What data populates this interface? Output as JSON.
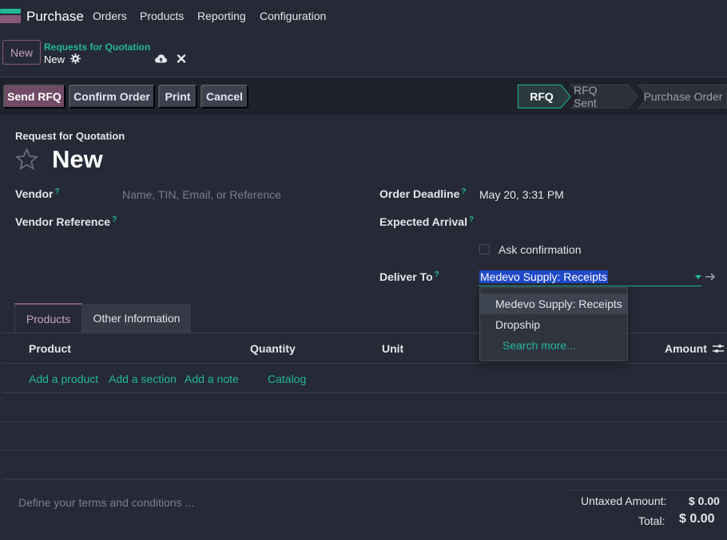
{
  "topnav": {
    "app_name": "Purchase",
    "items": [
      "Orders",
      "Products",
      "Reporting",
      "Configuration"
    ]
  },
  "control": {
    "new_label": "New",
    "breadcrumb_parent": "Requests for Quotation",
    "breadcrumb_current": "New",
    "icons": [
      "gear-icon",
      "cloud-upload-icon",
      "close-icon"
    ]
  },
  "statusbar": {
    "buttons": [
      "Send RFQ",
      "Confirm Order",
      "Print",
      "Cancel"
    ],
    "stages": [
      "RFQ",
      "RFQ Sent",
      "Purchase Order"
    ],
    "active_stage": "RFQ"
  },
  "form": {
    "subtitle": "Request for Quotation",
    "title": "New",
    "vendor_label": "Vendor",
    "vendor_placeholder": "Name, TIN, Email, or Reference",
    "vendor_ref_label": "Vendor Reference",
    "order_deadline_label": "Order Deadline",
    "order_deadline_value": "May 20, 3:31 PM",
    "expected_arrival_label": "Expected Arrival",
    "ask_confirmation_label": "Ask confirmation",
    "deliver_to_label": "Deliver To",
    "deliver_to_value": "Medevo Supply: Receipts",
    "help_marker": "?"
  },
  "dropdown": {
    "options": [
      "Medevo Supply: Receipts",
      "Dropship"
    ],
    "search_more": "Search more..."
  },
  "tabs": [
    "Products",
    "Other Information"
  ],
  "lines": {
    "headers": [
      "Product",
      "Quantity",
      "Unit",
      "Amount"
    ],
    "actions": [
      "Add a product",
      "Add a section",
      "Add a note",
      "Catalog"
    ]
  },
  "footer": {
    "terms_placeholder": "Define your terms and conditions ...",
    "untaxed_label": "Untaxed Amount:",
    "untaxed_value": "$ 0.00",
    "total_label": "Total:",
    "total_value": "$ 0.00"
  },
  "colors": {
    "accent_teal": "#21b799",
    "brand_purple": "#714b67",
    "background": "#262a36"
  }
}
